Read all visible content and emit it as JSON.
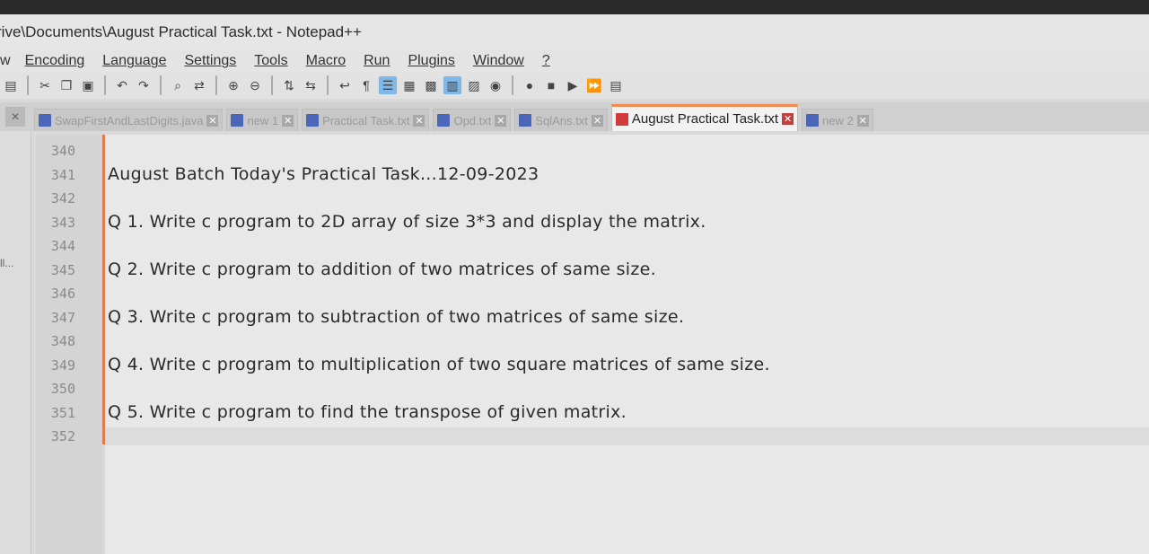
{
  "window": {
    "title": "rive\\Documents\\August Practical Task.txt - Notepad++"
  },
  "menu": [
    {
      "label": "w"
    },
    {
      "label": "Encoding"
    },
    {
      "label": "Language"
    },
    {
      "label": "Settings"
    },
    {
      "label": "Tools"
    },
    {
      "label": "Macro"
    },
    {
      "label": "Run"
    },
    {
      "label": "Plugins"
    },
    {
      "label": "Window"
    },
    {
      "label": "?"
    }
  ],
  "tabs": [
    {
      "label": "SwapFirstAndLastDigits.java"
    },
    {
      "label": "new 1"
    },
    {
      "label": "Practical Task.txt"
    },
    {
      "label": "Opd.txt"
    },
    {
      "label": "SqlAns.txt"
    },
    {
      "label": "August Practical Task.txt"
    },
    {
      "label": "new 2"
    }
  ],
  "side_label": "ll...",
  "editor": {
    "line_numbers": [
      "340",
      "341",
      "342",
      "343",
      "344",
      "345",
      "346",
      "347",
      "348",
      "349",
      "350",
      "351",
      "352"
    ],
    "lines": [
      "",
      "August  Batch Today's Practical Task...12-09-2023",
      "",
      "Q 1. Write c program to 2D array of size 3*3 and display the matrix.",
      "",
      "Q 2. Write c program to addition of two matrices of same size.",
      "",
      "Q 3. Write c program to subtraction of two matrices of same size.",
      "",
      "Q 4. Write c program to multiplication of two square matrices of same size.",
      "",
      "Q 5. Write c program to find the transpose of given matrix.",
      ""
    ]
  },
  "colors": {
    "active_tab_accent": "#f08a50",
    "fold_margin": "#e07a50"
  }
}
